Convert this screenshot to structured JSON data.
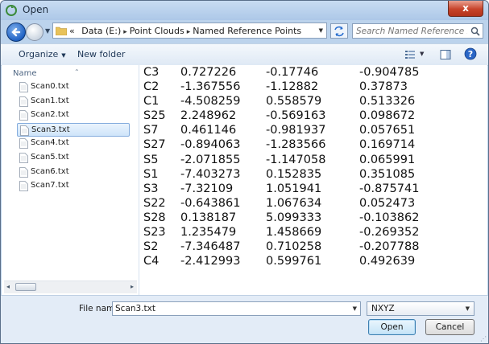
{
  "window": {
    "title": "Open",
    "close_label": "x"
  },
  "nav": {
    "breadcrumbs": [
      "Data (E:)",
      "Point Clouds",
      "Named Reference Points"
    ],
    "breadcrumb_prefix": "«",
    "search_placeholder": "Search Named Reference Points"
  },
  "toolbar": {
    "organize_label": "Organize",
    "new_folder_label": "New folder"
  },
  "sidebar": {
    "column_header": "Name",
    "files": [
      "Scan0.txt",
      "Scan1.txt",
      "Scan2.txt",
      "Scan3.txt",
      "Scan4.txt",
      "Scan5.txt",
      "Scan6.txt",
      "Scan7.txt"
    ],
    "selected_index": 3
  },
  "points": [
    [
      "C3",
      "0.727226",
      "-0.17746",
      "-0.904785"
    ],
    [
      "C2",
      "-1.367556",
      "-1.12882",
      "0.37873"
    ],
    [
      "C1",
      "-4.508259",
      "0.558579",
      "0.513326"
    ],
    [
      "S25",
      "2.248962",
      "-0.569163",
      "0.098672"
    ],
    [
      "S7",
      "0.461146",
      "-0.981937",
      "0.057651"
    ],
    [
      "S27",
      "-0.894063",
      "-1.283566",
      "0.169714"
    ],
    [
      "S5",
      "-2.071855",
      "-1.147058",
      "0.065991"
    ],
    [
      "S1",
      "-7.403273",
      "0.152835",
      "0.351085"
    ],
    [
      "S3",
      "-7.32109",
      "1.051941",
      "-0.875741"
    ],
    [
      "S22",
      "-0.643861",
      "1.067634",
      "0.052473"
    ],
    [
      "S28",
      "0.138187",
      "5.099333",
      "-0.103862"
    ],
    [
      "S23",
      "1.235479",
      "1.458669",
      "-0.269352"
    ],
    [
      "S2",
      "-7.346487",
      "0.710258",
      "-0.207788"
    ],
    [
      "C4",
      "-2.412993",
      "0.599761",
      "0.492639"
    ]
  ],
  "bottom": {
    "file_name_label": "File name:",
    "file_name_value": "Scan3.txt",
    "file_type_value": "NXYZ",
    "open_label": "Open",
    "cancel_label": "Cancel"
  },
  "colors": {
    "accent": "#2062c4",
    "selection": "#cfe5fa",
    "chrome": "#bcd3ec"
  }
}
